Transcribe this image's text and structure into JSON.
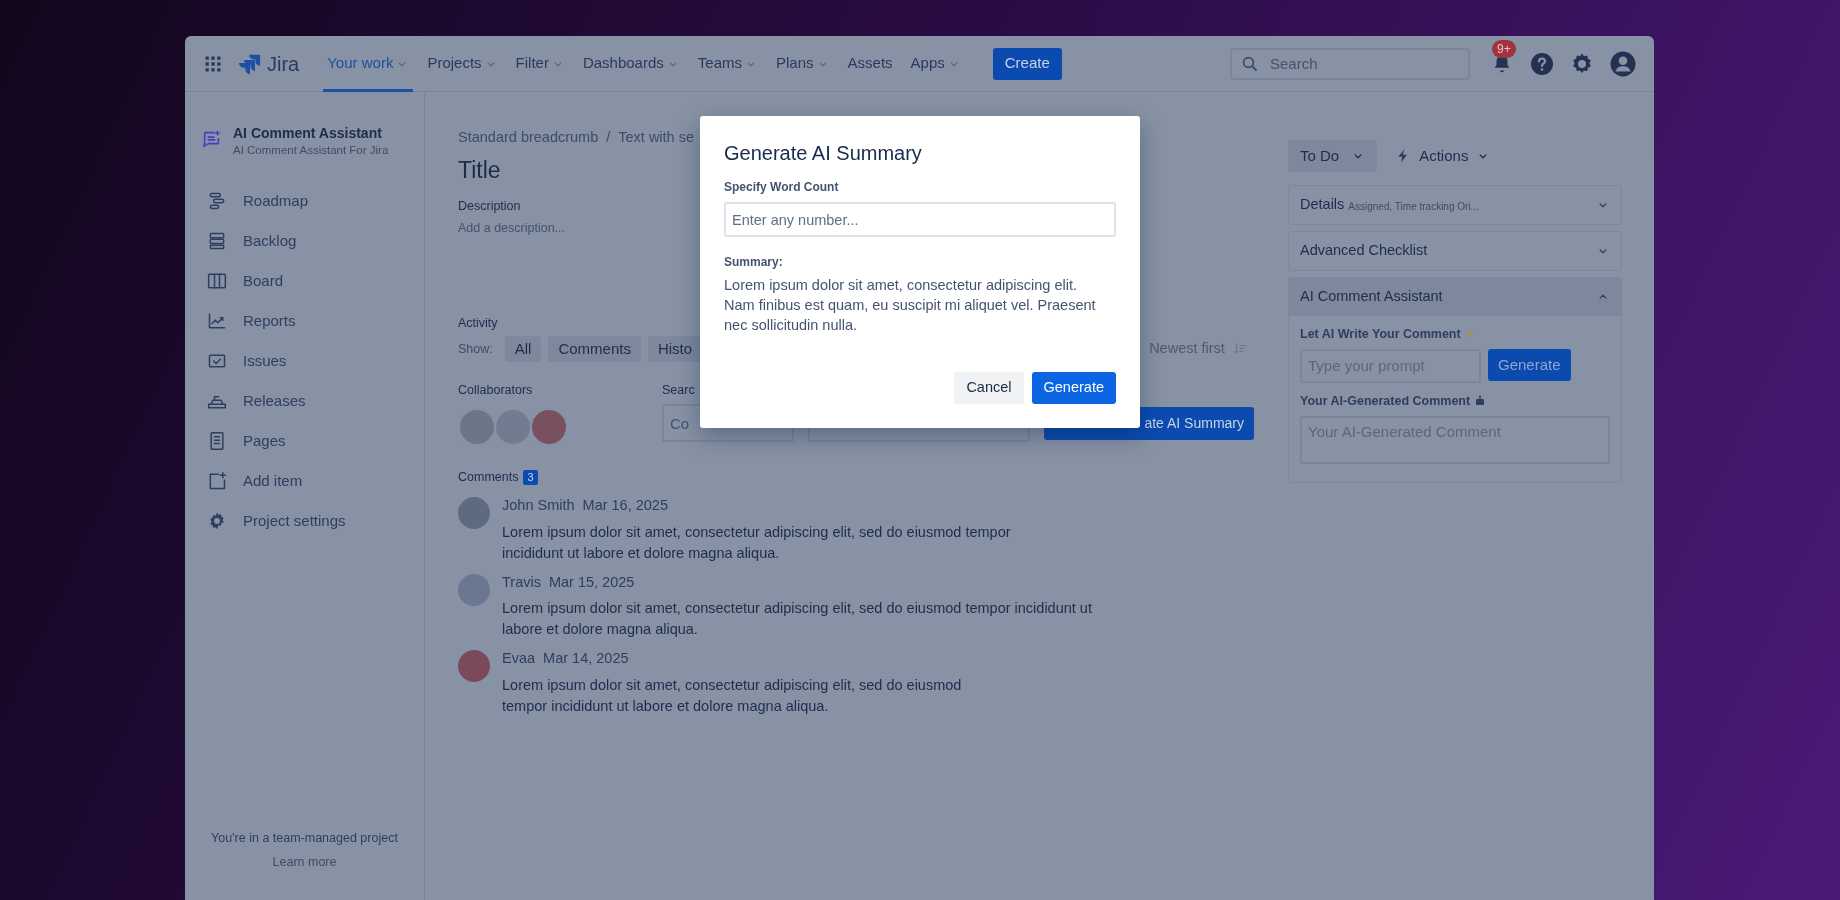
{
  "nav": {
    "app_name": "Jira",
    "items": [
      {
        "label": "Your work",
        "selected": true,
        "caret": true
      },
      {
        "label": "Projects",
        "selected": false,
        "caret": true
      },
      {
        "label": "Filter",
        "selected": false,
        "caret": true
      },
      {
        "label": "Dashboards",
        "selected": false,
        "caret": true
      },
      {
        "label": "Teams",
        "selected": false,
        "caret": true
      },
      {
        "label": "Plans",
        "selected": false,
        "caret": true
      },
      {
        "label": "Assets",
        "selected": false,
        "caret": false
      },
      {
        "label": "Apps",
        "selected": false,
        "caret": true
      }
    ],
    "create": "Create",
    "search": {
      "placeholder": "Search"
    },
    "notifications_badge": "9+"
  },
  "sidebar": {
    "project": {
      "name": "AI Comment Assistant",
      "subtitle": "AI Comment Assistant For Jira"
    },
    "items": [
      {
        "label": "Roadmap"
      },
      {
        "label": "Backlog"
      },
      {
        "label": "Board"
      },
      {
        "label": "Reports"
      },
      {
        "label": "Issues"
      },
      {
        "label": "Releases"
      },
      {
        "label": "Pages"
      },
      {
        "label": "Add item"
      },
      {
        "label": "Project settings"
      }
    ],
    "footer": {
      "text": "You're in a team-managed project",
      "link": "Learn more"
    }
  },
  "issue": {
    "breadcrumb": [
      "Standard breadcrumb",
      "Text with se"
    ],
    "breadcrumb_separator": "/",
    "title": "Title",
    "description": {
      "label": "Description",
      "placeholder": "Add a description..."
    },
    "activity": {
      "label": "Activity",
      "show_label": "Show:",
      "filters": [
        {
          "label": "All"
        },
        {
          "label": "Comments"
        },
        {
          "label": "Histo"
        }
      ],
      "sort": "Newest first"
    },
    "collaborators": {
      "label": "Collaborators"
    },
    "search": {
      "label": "Searc",
      "placeholder": "Co",
      "button": "ate AI Summary"
    },
    "comments": {
      "label": "Comments",
      "count": "3",
      "items": [
        {
          "author": "John Smith",
          "date": "Mar 16, 2025",
          "text": "Lorem ipsum dolor sit amet, consectetur adipiscing elit, sed do eiusmod tempor\nincididunt ut labore et dolore magna aliqua."
        },
        {
          "author": "Travis",
          "date": "Mar 15, 2025",
          "text": "Lorem ipsum dolor sit amet, consectetur adipiscing elit, sed do eiusmod tempor incididunt ut\nlabore et dolore magna aliqua."
        },
        {
          "author": "Evaa",
          "date": "Mar 14, 2025",
          "text": "Lorem ipsum dolor sit amet, consectetur adipiscing elit, sed do eiusmod\ntempor incididunt ut labore et dolore magna aliqua."
        }
      ]
    }
  },
  "side_panel": {
    "status": "To Do",
    "actions": "Actions",
    "panels": [
      {
        "title": "Details",
        "subtitle": "Assigned, Time tracking Ori...",
        "expanded": false
      },
      {
        "title": "Advanced Checklist",
        "expanded": false
      },
      {
        "title": "AI Comment Assistant",
        "expanded": true
      }
    ],
    "assistant": {
      "prompt_label": "Let AI Write Your Comment",
      "prompt_placeholder": "Type your prompt",
      "generate": "Generate",
      "output_label": "Your AI-Generated Comment",
      "output_placeholder": "Your AI-Generated Comment"
    }
  },
  "modal": {
    "title": "Generate AI Summary",
    "field_label": "Specify Word Count",
    "placeholder": "Enter any number...",
    "summary_label": "Summary:",
    "summary": "Lorem ipsum dolor sit amet, consectetur adipiscing elit.\nNam finibus est quam, eu suscipit mi aliquet vel. Praesent\nnec sollicitudin nulla.",
    "cancel": "Cancel",
    "confirm": "Generate"
  }
}
